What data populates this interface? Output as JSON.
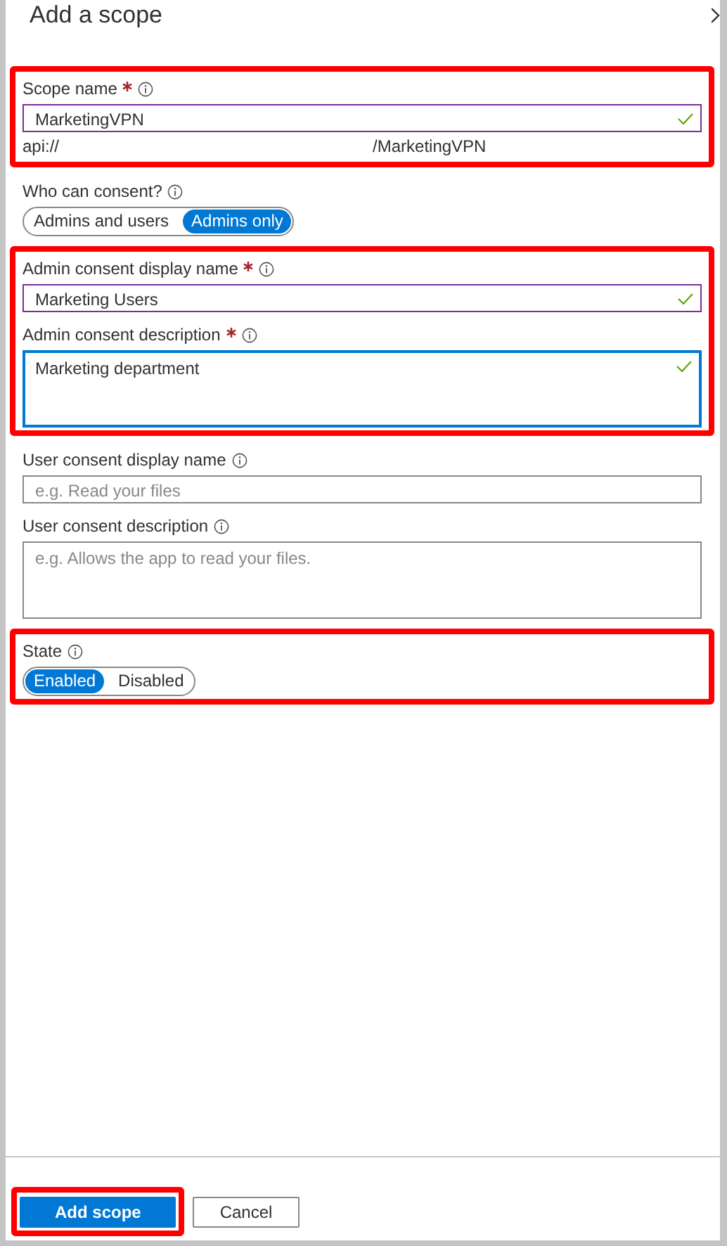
{
  "title": "Add a scope",
  "sections": [
    {
      "highlighted": true,
      "fields": [
        {
          "kind": "input",
          "label": "Scope name",
          "required": true,
          "value": "MarketingVPN",
          "hovered": true,
          "focused": false,
          "valid": true
        },
        {
          "kind": "uri",
          "prefix": "api://",
          "suffix": "/MarketingVPN"
        }
      ]
    },
    {
      "highlighted": false,
      "fields": [
        {
          "kind": "toggle",
          "label": "Who can consent?",
          "required": false,
          "options": [
            {
              "label": "Admins and users",
              "selected": false
            },
            {
              "label": "Admins only",
              "selected": true
            }
          ]
        }
      ]
    },
    {
      "highlighted": true,
      "fields": [
        {
          "kind": "input",
          "label": "Admin consent display name",
          "required": true,
          "value": "Marketing Users",
          "hovered": true,
          "focused": false,
          "valid": true
        },
        {
          "kind": "textarea",
          "label": "Admin consent description",
          "required": true,
          "value": "Marketing department",
          "hovered": false,
          "focused": true,
          "valid": true
        }
      ]
    },
    {
      "highlighted": false,
      "fields": [
        {
          "kind": "input",
          "label": "User consent display name",
          "required": false,
          "placeholder": "e.g. Read your files",
          "hovered": false,
          "focused": false,
          "valid": false
        },
        {
          "kind": "textarea",
          "label": "User consent description",
          "required": false,
          "placeholder": "e.g. Allows the app to read your files.",
          "hovered": false,
          "focused": false,
          "valid": false
        }
      ]
    },
    {
      "highlighted": true,
      "fields": [
        {
          "kind": "toggle",
          "label": "State",
          "required": false,
          "options": [
            {
              "label": "Enabled",
              "selected": true
            },
            {
              "label": "Disabled",
              "selected": false
            }
          ]
        }
      ]
    }
  ],
  "buttons": [
    {
      "label": "Add scope",
      "primary": true,
      "highlighted": true
    },
    {
      "label": "Cancel",
      "primary": false,
      "highlighted": false
    }
  ]
}
